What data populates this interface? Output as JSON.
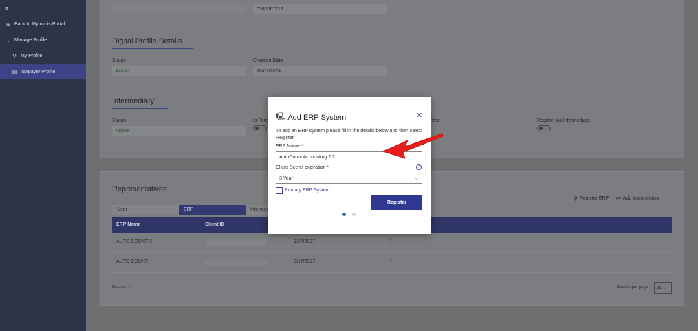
{
  "sidebar": {
    "hamburger": "≡",
    "items": [
      {
        "label": "Back to MyInvois Portal",
        "icon": "back-circle-icon"
      },
      {
        "label": "Manage Profile",
        "icon": "chevron-down-icon"
      },
      {
        "label": "My Profile",
        "icon": "person-icon"
      },
      {
        "label": "Taxpayer Profile",
        "icon": "document-icon",
        "active": true
      }
    ]
  },
  "profile": {
    "phone_value": "0380667719",
    "digital_title": "Digital Profile Details",
    "status_label": "Status",
    "status_value": "Active",
    "creation_label": "Creation Date",
    "creation_value": "28/07/2024",
    "intermediary_title": "Intermediary",
    "inter_status_label": "Status",
    "inter_status_value": "Active",
    "is_foreign_label": "Is Fore",
    "hosted_label": "nted",
    "register_intermediary_label": "Register As Intermediary"
  },
  "representatives": {
    "title": "Representatives",
    "tabs": [
      "User",
      "ERP",
      "Intermed"
    ],
    "register_erp": "Register ERP",
    "add_intermediary": "Add Intermediary",
    "columns": [
      "ERP Name",
      "Client ID"
    ],
    "rows": [
      {
        "name": "AUTO COUNT 2",
        "expiry": "31/7/2027"
      },
      {
        "name": "AUTO COUNT",
        "expiry": "31/7/2027"
      }
    ],
    "results": "Results: 2",
    "per_page_label": "Results per page:",
    "per_page_value": "10"
  },
  "modal": {
    "title": "Add ERP System",
    "close": "✕",
    "description": "To add an ERP system please fill in the details below and then select Register.",
    "erp_name_label": "ERP Name",
    "erp_name_value": "AutoCount Accounting 2.2",
    "secret_label": "Client Secret expiration",
    "secret_value": "3 Year",
    "required_mark": "*",
    "primary_label": "Primary ERP System",
    "register_button": "Register",
    "active_step": 1,
    "total_steps": 2
  },
  "colors": {
    "accent": "#2f3892",
    "arrow": "#e81e1e"
  }
}
